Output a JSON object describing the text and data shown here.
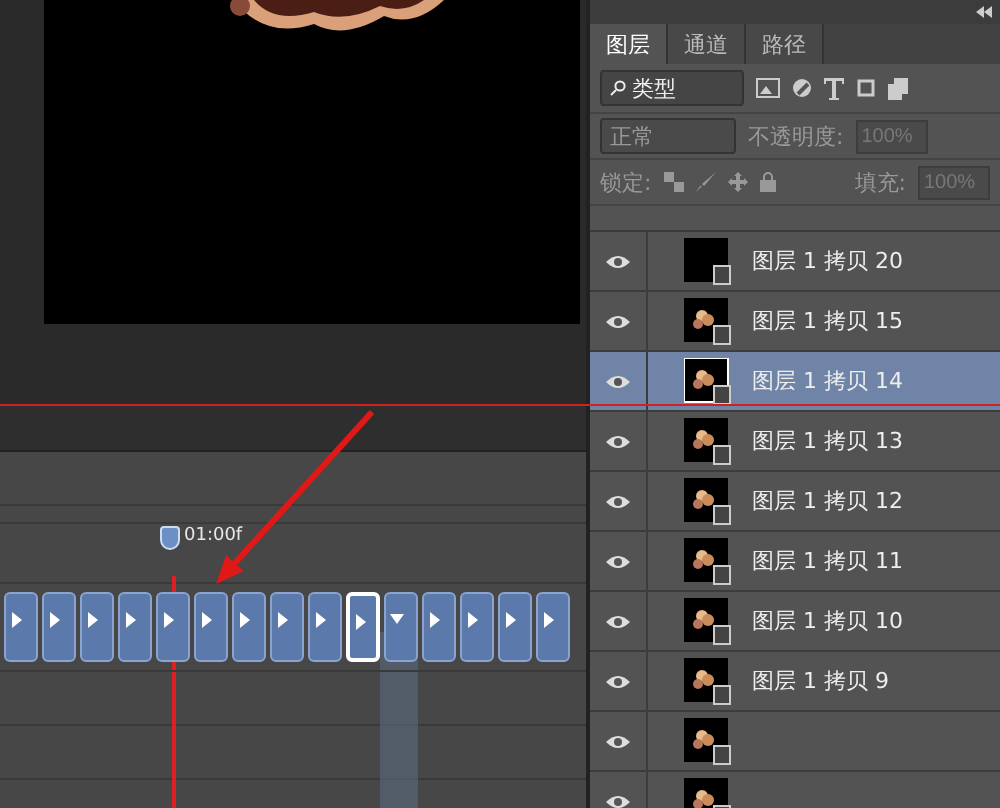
{
  "layers_panel": {
    "tabs": [
      {
        "label": "图层",
        "selected": true
      },
      {
        "label": "通道",
        "selected": false
      },
      {
        "label": "路径",
        "selected": false
      }
    ],
    "filter": {
      "value": "类型"
    },
    "blend": {
      "mode": "正常",
      "opacity_label": "不透明度:",
      "opacity": "100%"
    },
    "lock": {
      "label": "锁定:",
      "fill_label": "填充:",
      "fill": "100%"
    },
    "layers": [
      {
        "name": "图层 1 拷贝 20",
        "visible": true,
        "selected": false,
        "kind": "empty"
      },
      {
        "name": "图层 1 拷贝 15",
        "visible": true,
        "selected": false,
        "kind": "art"
      },
      {
        "name": "图层 1 拷贝 14",
        "visible": true,
        "selected": true,
        "kind": "art"
      },
      {
        "name": "图层 1 拷贝 13",
        "visible": true,
        "selected": false,
        "kind": "art"
      },
      {
        "name": "图层 1 拷贝 12",
        "visible": true,
        "selected": false,
        "kind": "art"
      },
      {
        "name": "图层 1 拷贝 11",
        "visible": true,
        "selected": false,
        "kind": "art"
      },
      {
        "name": "图层 1 拷贝 10",
        "visible": true,
        "selected": false,
        "kind": "art"
      },
      {
        "name": "图层 1 拷贝 9",
        "visible": true,
        "selected": false,
        "kind": "art"
      },
      {
        "visible": true,
        "selected": false,
        "kind": "art"
      },
      {
        "visible": true,
        "selected": false,
        "kind": "art"
      }
    ]
  },
  "timeline": {
    "playhead": "01:00f",
    "clips": [
      {
        "selected": false,
        "expanded": false
      },
      {
        "selected": false,
        "expanded": false
      },
      {
        "selected": false,
        "expanded": false
      },
      {
        "selected": false,
        "expanded": false
      },
      {
        "selected": false,
        "expanded": false
      },
      {
        "selected": false,
        "expanded": false
      },
      {
        "selected": false,
        "expanded": false
      },
      {
        "selected": false,
        "expanded": false
      },
      {
        "selected": false,
        "expanded": false
      },
      {
        "selected": true,
        "expanded": false
      },
      {
        "selected": false,
        "expanded": true
      },
      {
        "selected": false,
        "expanded": false
      },
      {
        "selected": false,
        "expanded": false
      },
      {
        "selected": false,
        "expanded": false
      },
      {
        "selected": false,
        "expanded": false
      }
    ]
  }
}
